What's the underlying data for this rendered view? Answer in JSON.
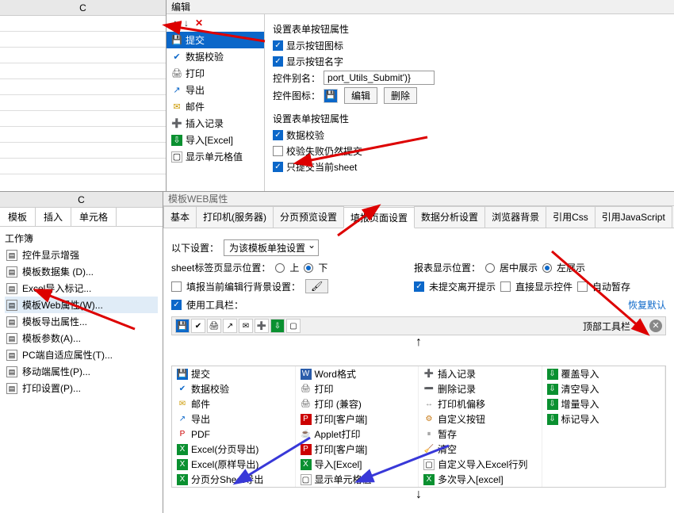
{
  "top": {
    "col_header": "C",
    "edit_title": "编辑",
    "close_x": "×",
    "list_items": [
      {
        "icon": "save",
        "label": "提交",
        "selected": true
      },
      {
        "icon": "check",
        "label": "数据校验"
      },
      {
        "icon": "print",
        "label": "打印"
      },
      {
        "icon": "export",
        "label": "导出"
      },
      {
        "icon": "mail",
        "label": "邮件"
      },
      {
        "icon": "insert",
        "label": "插入记录"
      },
      {
        "icon": "import",
        "label": "导入[Excel]"
      },
      {
        "icon": "none",
        "label": "显示单元格值"
      }
    ],
    "section1_title": "设置表单按钮属性",
    "chk_show_icon": "显示按钮图标",
    "chk_show_name": "显示按钮名字",
    "alias_label": "控件别名：",
    "alias_value": "port_Utils_Submit')}",
    "icon_label": "控件图标：",
    "btn_edit": "编辑",
    "btn_delete": "删除",
    "section2_title": "设置表单按钮属性",
    "chk_data_validate": "数据校验",
    "chk_fail_submit": "校验失败仍然提交",
    "chk_current_sheet": "只提交当前sheet"
  },
  "side": {
    "col_header": "C",
    "tabs": [
      "模板",
      "插入",
      "单元格"
    ],
    "section_label": "工作簿",
    "items": [
      {
        "label": "控件显示增强"
      },
      {
        "label": "模板数据集 (D)..."
      },
      {
        "label": "Excel导入标记..."
      },
      {
        "label": "模板Web属性(W)...",
        "highlight": true
      },
      {
        "label": "模板导出属性..."
      },
      {
        "label": "模板参数(A)..."
      },
      {
        "label": "PC端自适应属性(T)..."
      },
      {
        "label": "移动端属性(P)..."
      },
      {
        "label": "打印设置(P)..."
      }
    ]
  },
  "main": {
    "title": "模板WEB属性",
    "tabs": [
      "基本",
      "打印机(服务器)",
      "分页预览设置",
      "填报页面设置",
      "数据分析设置",
      "浏览器背景",
      "引用Css",
      "引用JavaScript"
    ],
    "active_tab": 3,
    "setting_label": "以下设置：",
    "setting_value": "为该模板单独设置",
    "sheet_pos_label": "sheet标签页显示位置：",
    "opt_top": "上",
    "opt_bottom": "下",
    "report_pos_label": "报表显示位置：",
    "opt_center": "居中展示",
    "opt_left": "左展示",
    "chk_bg": "填报当前编辑行背景设置：",
    "chk_exit_prompt": "未提交离开提示",
    "chk_show_widget": "直接显示控件",
    "chk_auto_pause": "自动暂存",
    "chk_use_toolbar": "使用工具栏：",
    "restore_default": "恢复默认",
    "toolbar_label": "顶部工具栏",
    "avail": [
      [
        {
          "ic": "save",
          "t": "提交"
        },
        {
          "ic": "word",
          "t": "Word格式"
        },
        {
          "ic": "ins",
          "t": "插入记录"
        },
        {
          "ic": "cov",
          "t": "覆盖导入"
        }
      ],
      [
        {
          "ic": "chk",
          "t": "数据校验"
        },
        {
          "ic": "print",
          "t": "打印"
        },
        {
          "ic": "del",
          "t": "删除记录"
        },
        {
          "ic": "cov",
          "t": "清空导入"
        }
      ],
      [
        {
          "ic": "mail",
          "t": "邮件"
        },
        {
          "ic": "print",
          "t": "打印 (兼容)"
        },
        {
          "ic": "mov",
          "t": "打印机偏移"
        },
        {
          "ic": "cov",
          "t": "增量导入"
        }
      ],
      [
        {
          "ic": "exp",
          "t": "导出"
        },
        {
          "ic": "pdf2",
          "t": "打印[客户端]"
        },
        {
          "ic": "cust",
          "t": "自定义按钮"
        },
        {
          "ic": "cov",
          "t": "标记导入"
        }
      ],
      [
        {
          "ic": "pdf",
          "t": "PDF"
        },
        {
          "ic": "app",
          "t": "Applet打印"
        },
        {
          "ic": "pause",
          "t": "暂存"
        },
        {
          "ic": "",
          "t": ""
        }
      ],
      [
        {
          "ic": "xls",
          "t": "Excel(分页导出)"
        },
        {
          "ic": "pdf2",
          "t": "打印[客户端]"
        },
        {
          "ic": "clear",
          "t": "清空"
        },
        {
          "ic": "",
          "t": ""
        }
      ],
      [
        {
          "ic": "xls",
          "t": "Excel(原样导出)"
        },
        {
          "ic": "xls",
          "t": "导入[Excel]"
        },
        {
          "ic": "none",
          "t": "自定义导入Excel行列"
        },
        {
          "ic": "",
          "t": ""
        }
      ],
      [
        {
          "ic": "xls",
          "t": "分页分Sheet导出"
        },
        {
          "ic": "none",
          "t": "显示单元格值"
        },
        {
          "ic": "xls",
          "t": "多次导入[excel]"
        },
        {
          "ic": "",
          "t": ""
        }
      ]
    ]
  }
}
